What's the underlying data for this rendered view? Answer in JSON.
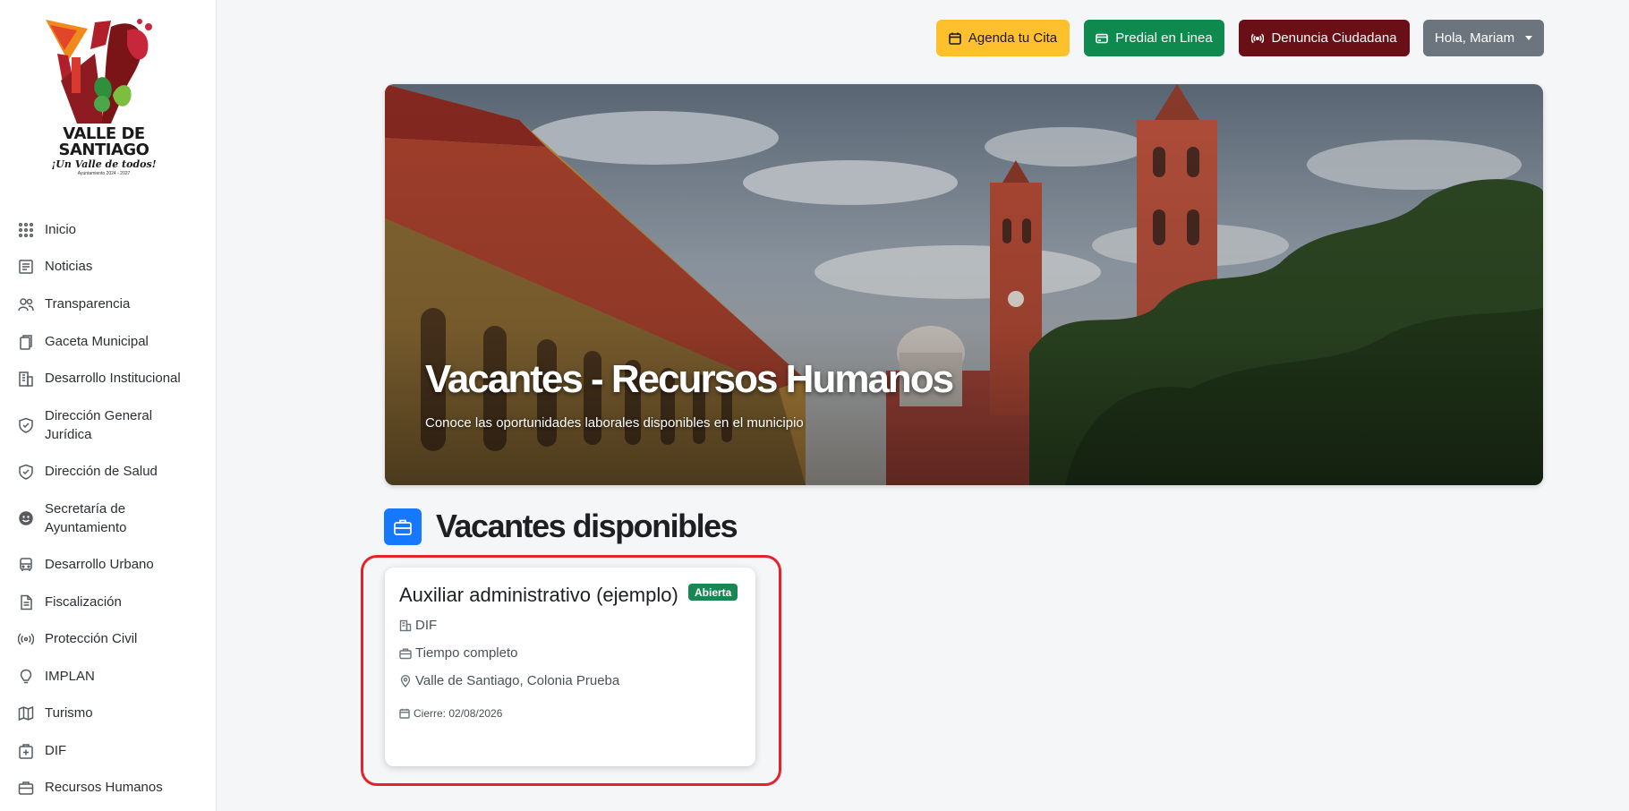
{
  "logo": {
    "title_line1": "VALLE DE",
    "title_line2": "SANTIAGO",
    "tagline": "¡Un Valle de todos!",
    "period": "Ayuntamiento 2024 - 2027"
  },
  "sidebar": {
    "items": [
      {
        "label": "Inicio",
        "icon": "grid-icon"
      },
      {
        "label": "Noticias",
        "icon": "newspaper-icon"
      },
      {
        "label": "Transparencia",
        "icon": "people-icon"
      },
      {
        "label": "Gaceta Municipal",
        "icon": "documents-icon"
      },
      {
        "label": "Desarrollo Institucional",
        "icon": "building-icon"
      },
      {
        "label": "Dirección General Jurídica",
        "icon": "shield-icon"
      },
      {
        "label": "Dirección de Salud",
        "icon": "shield-check-icon"
      },
      {
        "label": "Secretaría de Ayuntamiento",
        "icon": "emoji-icon"
      },
      {
        "label": "Desarrollo Urbano",
        "icon": "bus-icon"
      },
      {
        "label": "Fiscalización",
        "icon": "file-icon"
      },
      {
        "label": "Protección Civil",
        "icon": "broadcast-icon"
      },
      {
        "label": "IMPLAN",
        "icon": "lightbulb-icon"
      },
      {
        "label": "Turismo",
        "icon": "map-icon"
      },
      {
        "label": "DIF",
        "icon": "hospital-icon"
      },
      {
        "label": "Recursos Humanos",
        "icon": "briefcase-icon"
      }
    ]
  },
  "topbar": {
    "agenda_label": "Agenda tu Cita",
    "predial_label": "Predial en Linea",
    "denuncia_label": "Denuncia Ciudadana",
    "user_label": "Hola, Mariam"
  },
  "hero": {
    "title": "Vacantes - Recursos Humanos",
    "subtitle": "Conoce las oportunidades laborales disponibles en el municipio"
  },
  "section": {
    "title": "Vacantes disponibles"
  },
  "vacancies": [
    {
      "title": "Auxiliar administrativo (ejemplo)",
      "status": "Abierta",
      "department": "DIF",
      "schedule": "Tiempo completo",
      "location": "Valle de Santiago, Colonia Prueba",
      "closing": "Cierre: 02/08/2026"
    }
  ],
  "colors": {
    "agenda": "#ffc02e",
    "predial": "#0e8a4e",
    "denuncia": "#6a0f16",
    "user": "#6c757d",
    "section_icon": "#1677ff",
    "badge": "#198754",
    "highlight": "#e8202a"
  }
}
